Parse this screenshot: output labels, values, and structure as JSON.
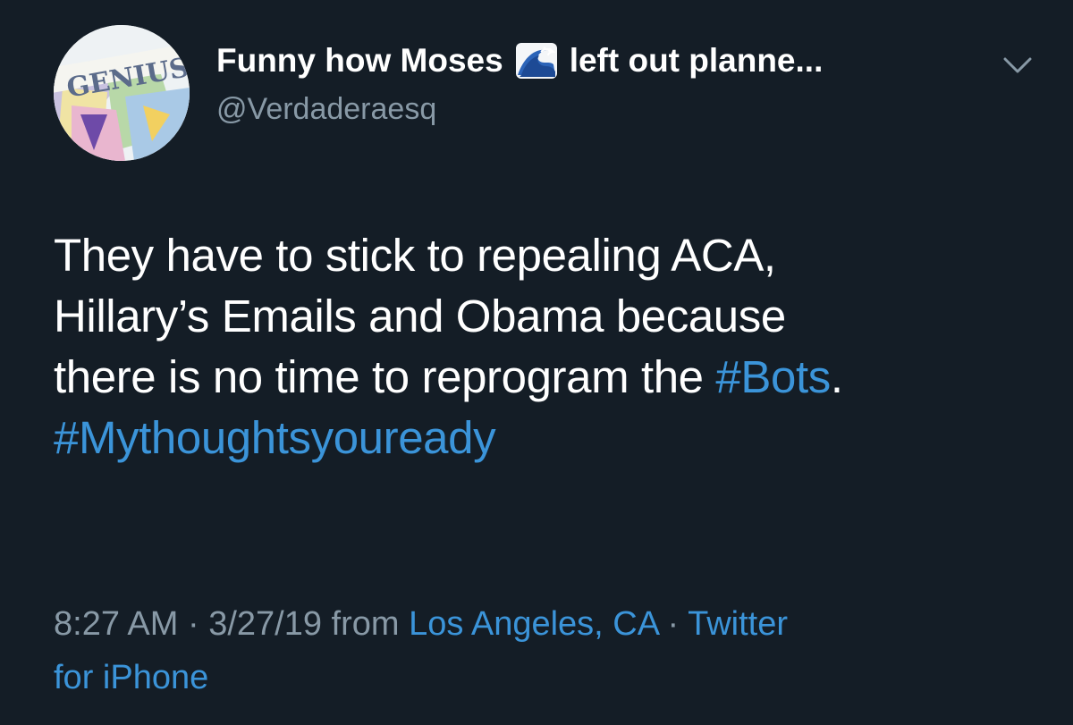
{
  "tweet": {
    "author": {
      "name_part1": "Funny how Moses",
      "name_emoji_icon": "water-wave-icon",
      "name_part2": "left out planne...",
      "handle": "@Verdaderaesq",
      "avatar_text": "GENIUS"
    },
    "text": {
      "line1": "They have to stick to repealing ACA,",
      "line2": "Hillary’s Emails and Obama because",
      "line3_prefix": "there is no time to reprogram the ",
      "hashtag_bots": "#Bots",
      "line3_suffix": ".",
      "hashtag_thoughts": "#Mythoughtsyouready"
    },
    "meta": {
      "time": "8:27 AM",
      "sep1": " · ",
      "date": "3/27/19",
      "from": " from ",
      "location": "Los Angeles, CA",
      "sep2": " · ",
      "source_part1": "Twitter",
      "source_part2": "for iPhone"
    }
  },
  "colors": {
    "background": "#141d26",
    "text": "#ffffff",
    "secondary": "#8899a6",
    "link": "#3b94d9"
  }
}
